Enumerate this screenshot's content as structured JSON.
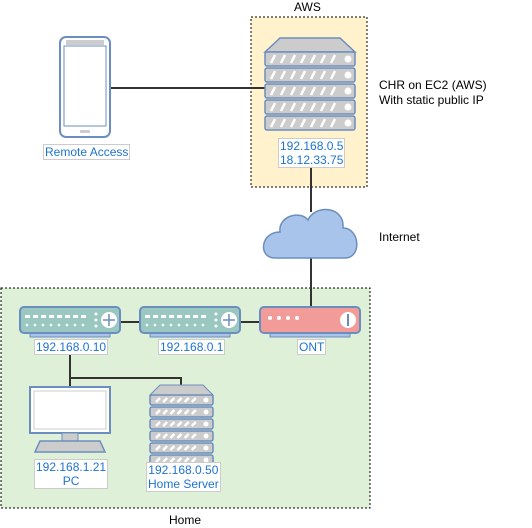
{
  "groups": {
    "aws": "AWS",
    "home": "Home"
  },
  "notes": {
    "chr_line1": "CHR on EC2 (AWS)",
    "chr_line2": "With static public IP",
    "internet": "Internet"
  },
  "nodes": {
    "phone": {
      "label": "Remote Access"
    },
    "aws_server": {
      "ip_private": "192.168.0.5",
      "ip_public": "18.12.33.75"
    },
    "switch1": {
      "label": "192.168.0.10"
    },
    "router": {
      "label": "192.168.0.1"
    },
    "ont": {
      "label": "ONT"
    },
    "pc": {
      "ip": "192.168.1.21",
      "name": "PC"
    },
    "home_server": {
      "ip": "192.168.0.50",
      "name": "Home Server"
    }
  },
  "colors": {
    "aws_bg": "#fff2cc",
    "home_bg": "#dff0d8",
    "switch": "#9ac7bf",
    "ont": "#f19c99",
    "cloud": "#a9c4eb",
    "stroke": "#6c8ebf",
    "label_text": "#1e73d2"
  }
}
